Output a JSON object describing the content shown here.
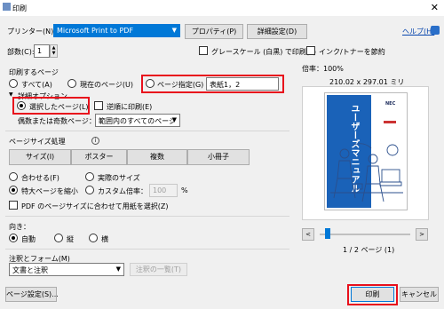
{
  "window": {
    "title": "印刷",
    "close_glyph": "✕"
  },
  "printer": {
    "label": "プリンター(N):",
    "selected": "Microsoft Print to PDF",
    "properties_button": "プロパティ(P)",
    "advanced_button": "詳細設定(D)",
    "help_link": "ヘルプ(H)"
  },
  "copies": {
    "label": "部数(C):",
    "value": "1",
    "grayscale_label": "グレースケール (白黒) で印刷(Y)",
    "save_ink_label": "インク/トナーを節約"
  },
  "pages_to_print": {
    "heading": "印刷するページ",
    "all_label": "すべて(A)",
    "current_label": "現在のページ(U)",
    "range_label": "ページ指定(G)",
    "range_value": "表紙1，2",
    "more_options": "詳細オプション",
    "selected_pages_label": "選択したページ(L)",
    "reverse_label": "逆順に印刷(E)",
    "odd_even_label": "偶数または奇数ページ：",
    "odd_even_value": "範囲内のすべてのページ"
  },
  "sizing": {
    "heading": "ページサイズ処理",
    "tabs": [
      "サイズ(I)",
      "ポスター",
      "複数",
      "小冊子"
    ],
    "fit_label": "合わせる(F)",
    "actual_label": "実際のサイズ",
    "shrink_label": "特大ページを縮小",
    "custom_label": "カスタム倍率：",
    "custom_value": "100",
    "custom_unit": "%",
    "paper_source_label": "PDF のページサイズに合わせて用紙を選択(Z)"
  },
  "orientation": {
    "heading": "向き：",
    "auto_label": "自動",
    "portrait_label": "縦",
    "landscape_label": "横"
  },
  "comments": {
    "heading": "注釈とフォーム(M)",
    "value": "文書と注釈",
    "summary_button": "注釈の一覧(T)"
  },
  "preview": {
    "scale": "倍率：100%",
    "dimensions": "210.02 x 297.01 ミリ",
    "cover_title": "ユーザーズマニュアル",
    "brand": "NEC",
    "page_indicator": "1 / 2 ページ (1)",
    "slider_position": 0.06
  },
  "footer": {
    "page_setup_button": "ページ設定(S)...",
    "print_button": "印刷",
    "cancel_button": "キャンセル"
  },
  "colors": {
    "accent": "#0078d7",
    "highlight": "#e8101c",
    "cover_blue": "#1a62b8"
  }
}
